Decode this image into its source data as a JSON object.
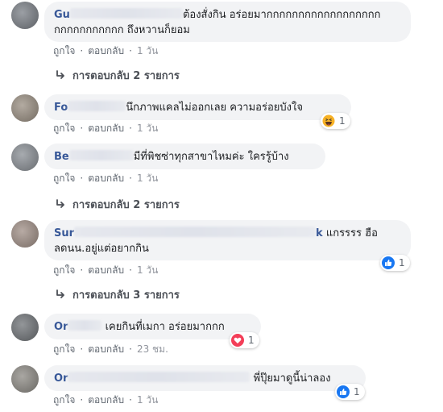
{
  "actions": {
    "like_label": "ถูกใจ",
    "reply_label": "ตอบกลับ",
    "separator": "·"
  },
  "comments": [
    {
      "name_visible": "Gu",
      "text_line1": "ต้องสั่งกิน อร่อยมากกกกกกกกกกกกกกกกกก",
      "text_line2": "กกกกกกกกกกก ถึงหวานก็ยอม",
      "time": "1 วัน",
      "replies_label": "การตอบกลับ 2 รายการ"
    },
    {
      "name_visible": "Fo",
      "text": "นึกภาพแคลไม่ออกเลย ความอร่อยบังใจ",
      "time": "1 วัน",
      "reaction": {
        "icon": "haha-emoji-icon",
        "count": "1"
      }
    },
    {
      "name_visible": "Be",
      "text": "มีที่พิชซ่าทุกสาขาไหมค่ะ ใครรู้บ้าง",
      "time": "1 วัน",
      "replies_label": "การตอบกลับ 2 รายการ"
    },
    {
      "name_visible": "Sur",
      "name_tail": "k",
      "text_line1": "แกรรรร ฮือ",
      "text_line2": "ลดนน.อยู่แต่อยากกิน",
      "time": "1 วัน",
      "reaction": {
        "icon": "like-thumb-icon",
        "count": "1"
      },
      "replies_label": "การตอบกลับ 3 รายการ"
    },
    {
      "name_visible": "Or",
      "text": "เคยกินที่เมกา อร่อยมากกก",
      "time": "23 ชม.",
      "reaction": {
        "icon": "love-heart-icon",
        "count": "1"
      }
    },
    {
      "name_visible": "Or",
      "text": "พี่ปุ๊ยมาดูนี้น่าลอง",
      "time": "1 วัน",
      "reaction": {
        "icon": "like-thumb-icon",
        "count": "1"
      }
    }
  ],
  "colors": {
    "bubble": "#f2f3f5",
    "name": "#385898",
    "meta": "#606770",
    "like_blue": "#1877f2",
    "love_red": "#f33e58",
    "haha_yellow": "#f7b125"
  }
}
